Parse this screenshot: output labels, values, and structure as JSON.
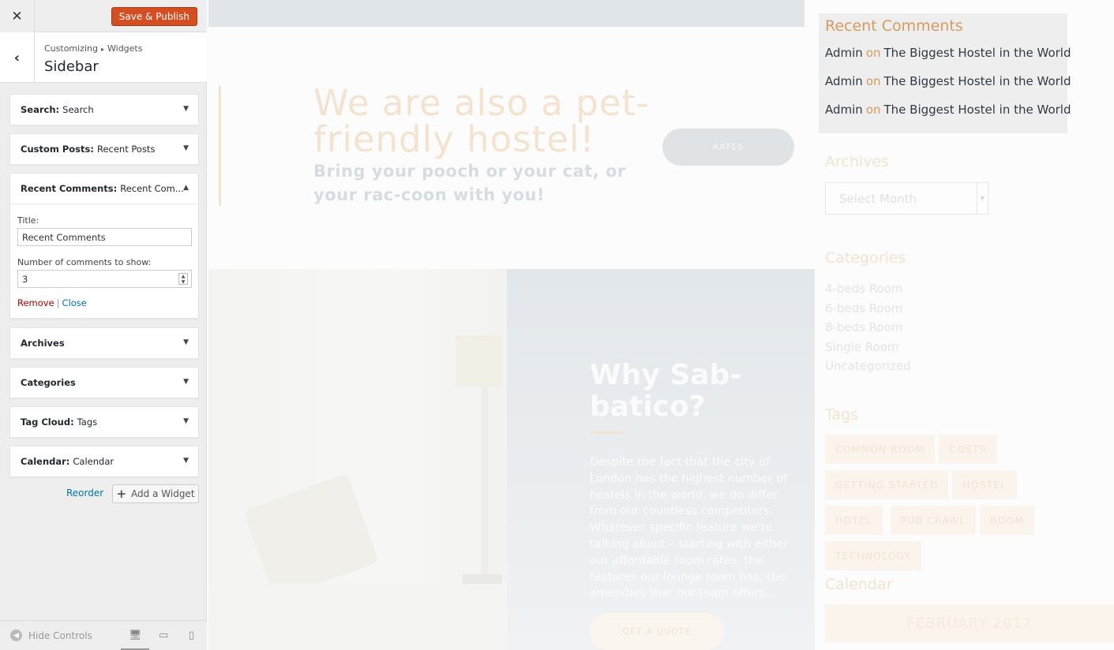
{
  "header": {
    "close_symbol": "✕",
    "save_label": "Save & Publish",
    "breadcrumb": [
      "Customizing",
      "Widgets"
    ],
    "breadcrumb_sep": "▸",
    "section_title": "Sidebar",
    "back_symbol": "‹"
  },
  "widgets": [
    {
      "type": "Search",
      "title": "Search"
    },
    {
      "type": "Custom Posts",
      "title": "Recent Posts"
    },
    {
      "type": "Recent Comments",
      "title": "Recent Com..."
    },
    {
      "type": "Archives",
      "title": ""
    },
    {
      "type": "Categories",
      "title": ""
    },
    {
      "type": "Tag Cloud",
      "title": "Tags"
    },
    {
      "type": "Calendar",
      "title": "Calendar"
    }
  ],
  "expanded_widget": {
    "title_label": "Title:",
    "title_value": "Recent Comments",
    "number_label": "Number of comments to show:",
    "number_value": "3",
    "remove_label": "Remove",
    "close_label": "Close"
  },
  "controls": {
    "reorder_label": "Reorder",
    "add_widget_label": "Add a Widget",
    "hide_controls_label": "Hide Controls"
  },
  "preview": {
    "promo_title": "We are also a pet-friendly hostel!",
    "promo_sub": "Bring your pooch or your cat, or your rac-coon with you!",
    "rates_label": "RATES",
    "why_title": "Why Sab-batico?",
    "why_text": "Despite the fact that the city of London has the highest number of hostels in the world, we do differ from our countless competitors. Whatever specific feature we’re talking about – starting with either our affordable room rates, the features our lounge room has, the amenities that our team offers…",
    "quote_label": "GET A QUOTE",
    "recent_comments_title": "Recent Comments",
    "comments": [
      {
        "author": "Admin",
        "on": "on",
        "post": "The Biggest Hostel in the World"
      },
      {
        "author": "Admin",
        "on": "on",
        "post": "The Biggest Hostel in the World"
      },
      {
        "author": "Admin",
        "on": "on",
        "post": "The Biggest Hostel in the World"
      }
    ],
    "archives_title": "Archives",
    "select_month": "Select Month",
    "categories_title": "Categories",
    "categories": [
      "4-beds Room",
      "6-beds Room",
      "8-beds Room",
      "Single Room",
      "Uncategorized"
    ],
    "tags_title": "Tags",
    "tags": [
      "COMMON ROOM",
      "COSTS",
      "GETTING STARTED",
      "HOSTEL",
      "HOTEL",
      "PUB CRAWL",
      "ROOM",
      "TECHNOLOGY"
    ],
    "calendar_title": "Calendar",
    "calendar_month": "FEBRUARY 2017"
  },
  "colors": {
    "save_button": "#d54e21",
    "link": "#0073aa",
    "remove": "#aa0000",
    "accent": "#d89a5e"
  }
}
